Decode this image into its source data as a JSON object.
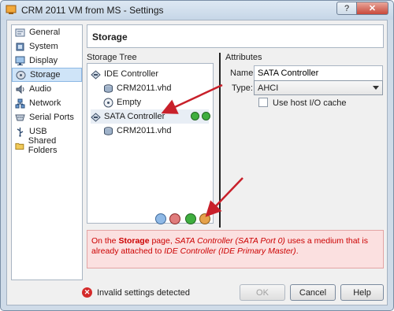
{
  "window": {
    "title": "CRM 2011 VM from MS - Settings",
    "help_glyph": "?",
    "close_glyph": "✕"
  },
  "sidebar": {
    "items": [
      {
        "label": "General",
        "icon": "general-icon"
      },
      {
        "label": "System",
        "icon": "system-icon"
      },
      {
        "label": "Display",
        "icon": "display-icon"
      },
      {
        "label": "Storage",
        "icon": "storage-icon",
        "selected": true
      },
      {
        "label": "Audio",
        "icon": "audio-icon"
      },
      {
        "label": "Network",
        "icon": "network-icon"
      },
      {
        "label": "Serial Ports",
        "icon": "serial-ports-icon"
      },
      {
        "label": "USB",
        "icon": "usb-icon"
      },
      {
        "label": "Shared Folders",
        "icon": "shared-folders-icon"
      }
    ]
  },
  "page": {
    "title": "Storage"
  },
  "storage_tree": {
    "label": "Storage Tree",
    "nodes": [
      {
        "label": "IDE Controller",
        "type": "controller"
      },
      {
        "label": "CRM2011.vhd",
        "type": "disk"
      },
      {
        "label": "Empty",
        "type": "optical"
      },
      {
        "label": "SATA Controller",
        "type": "controller",
        "selected": true
      },
      {
        "label": "CRM2011.vhd",
        "type": "disk"
      }
    ]
  },
  "attributes": {
    "label": "Attributes",
    "name_label": "Name:",
    "name_value": "SATA Controller",
    "type_label": "Type:",
    "type_value": "AHCI",
    "host_cache_label": "Use host I/O cache"
  },
  "message": {
    "prefix": "On the ",
    "page_name": "Storage",
    "middle": " page, ",
    "item": "SATA Controller (SATA Port 0)",
    "text": " uses a medium that is already attached to ",
    "target": "IDE Controller (IDE Primary Master)",
    "suffix": "."
  },
  "status": {
    "text": "Invalid settings detected"
  },
  "buttons": {
    "ok": "OK",
    "cancel": "Cancel",
    "help": "Help"
  },
  "colors": {
    "accent": "#3a7bd5",
    "error": "#cc0000",
    "annotation_arrow": "#c8202a"
  }
}
